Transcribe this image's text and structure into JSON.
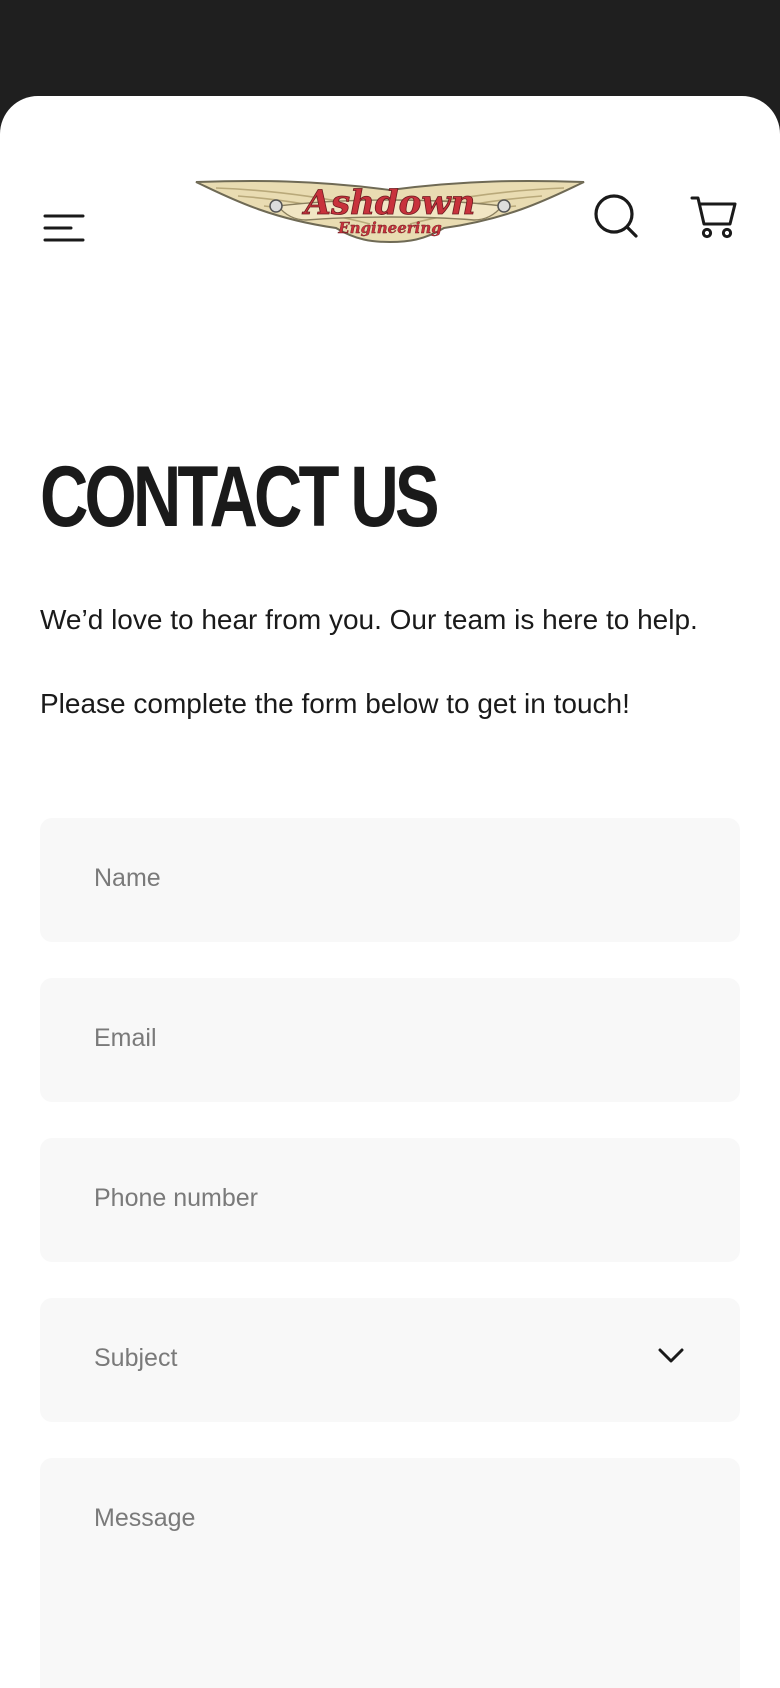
{
  "header": {
    "menu_icon": "hamburger-menu-icon",
    "logo_text": "Ashdown",
    "logo_subtext": "Engineering",
    "search_icon": "search-icon",
    "cart_icon": "cart-icon"
  },
  "main": {
    "title": "CONTACT US",
    "intro_line_1": "We’d love to hear from you. Our team is here to help.",
    "intro_line_2": "Please complete the form below to get in touch!"
  },
  "form": {
    "name_placeholder": "Name",
    "email_placeholder": "Email",
    "phone_placeholder": "Phone number",
    "subject_placeholder": "Subject",
    "message_placeholder": "Message"
  },
  "colors": {
    "top_bar": "#1f1f1f",
    "background": "#ffffff",
    "field_background": "#f8f8f8",
    "logo_red": "#c8323c",
    "logo_cream": "#e9dcb2"
  }
}
